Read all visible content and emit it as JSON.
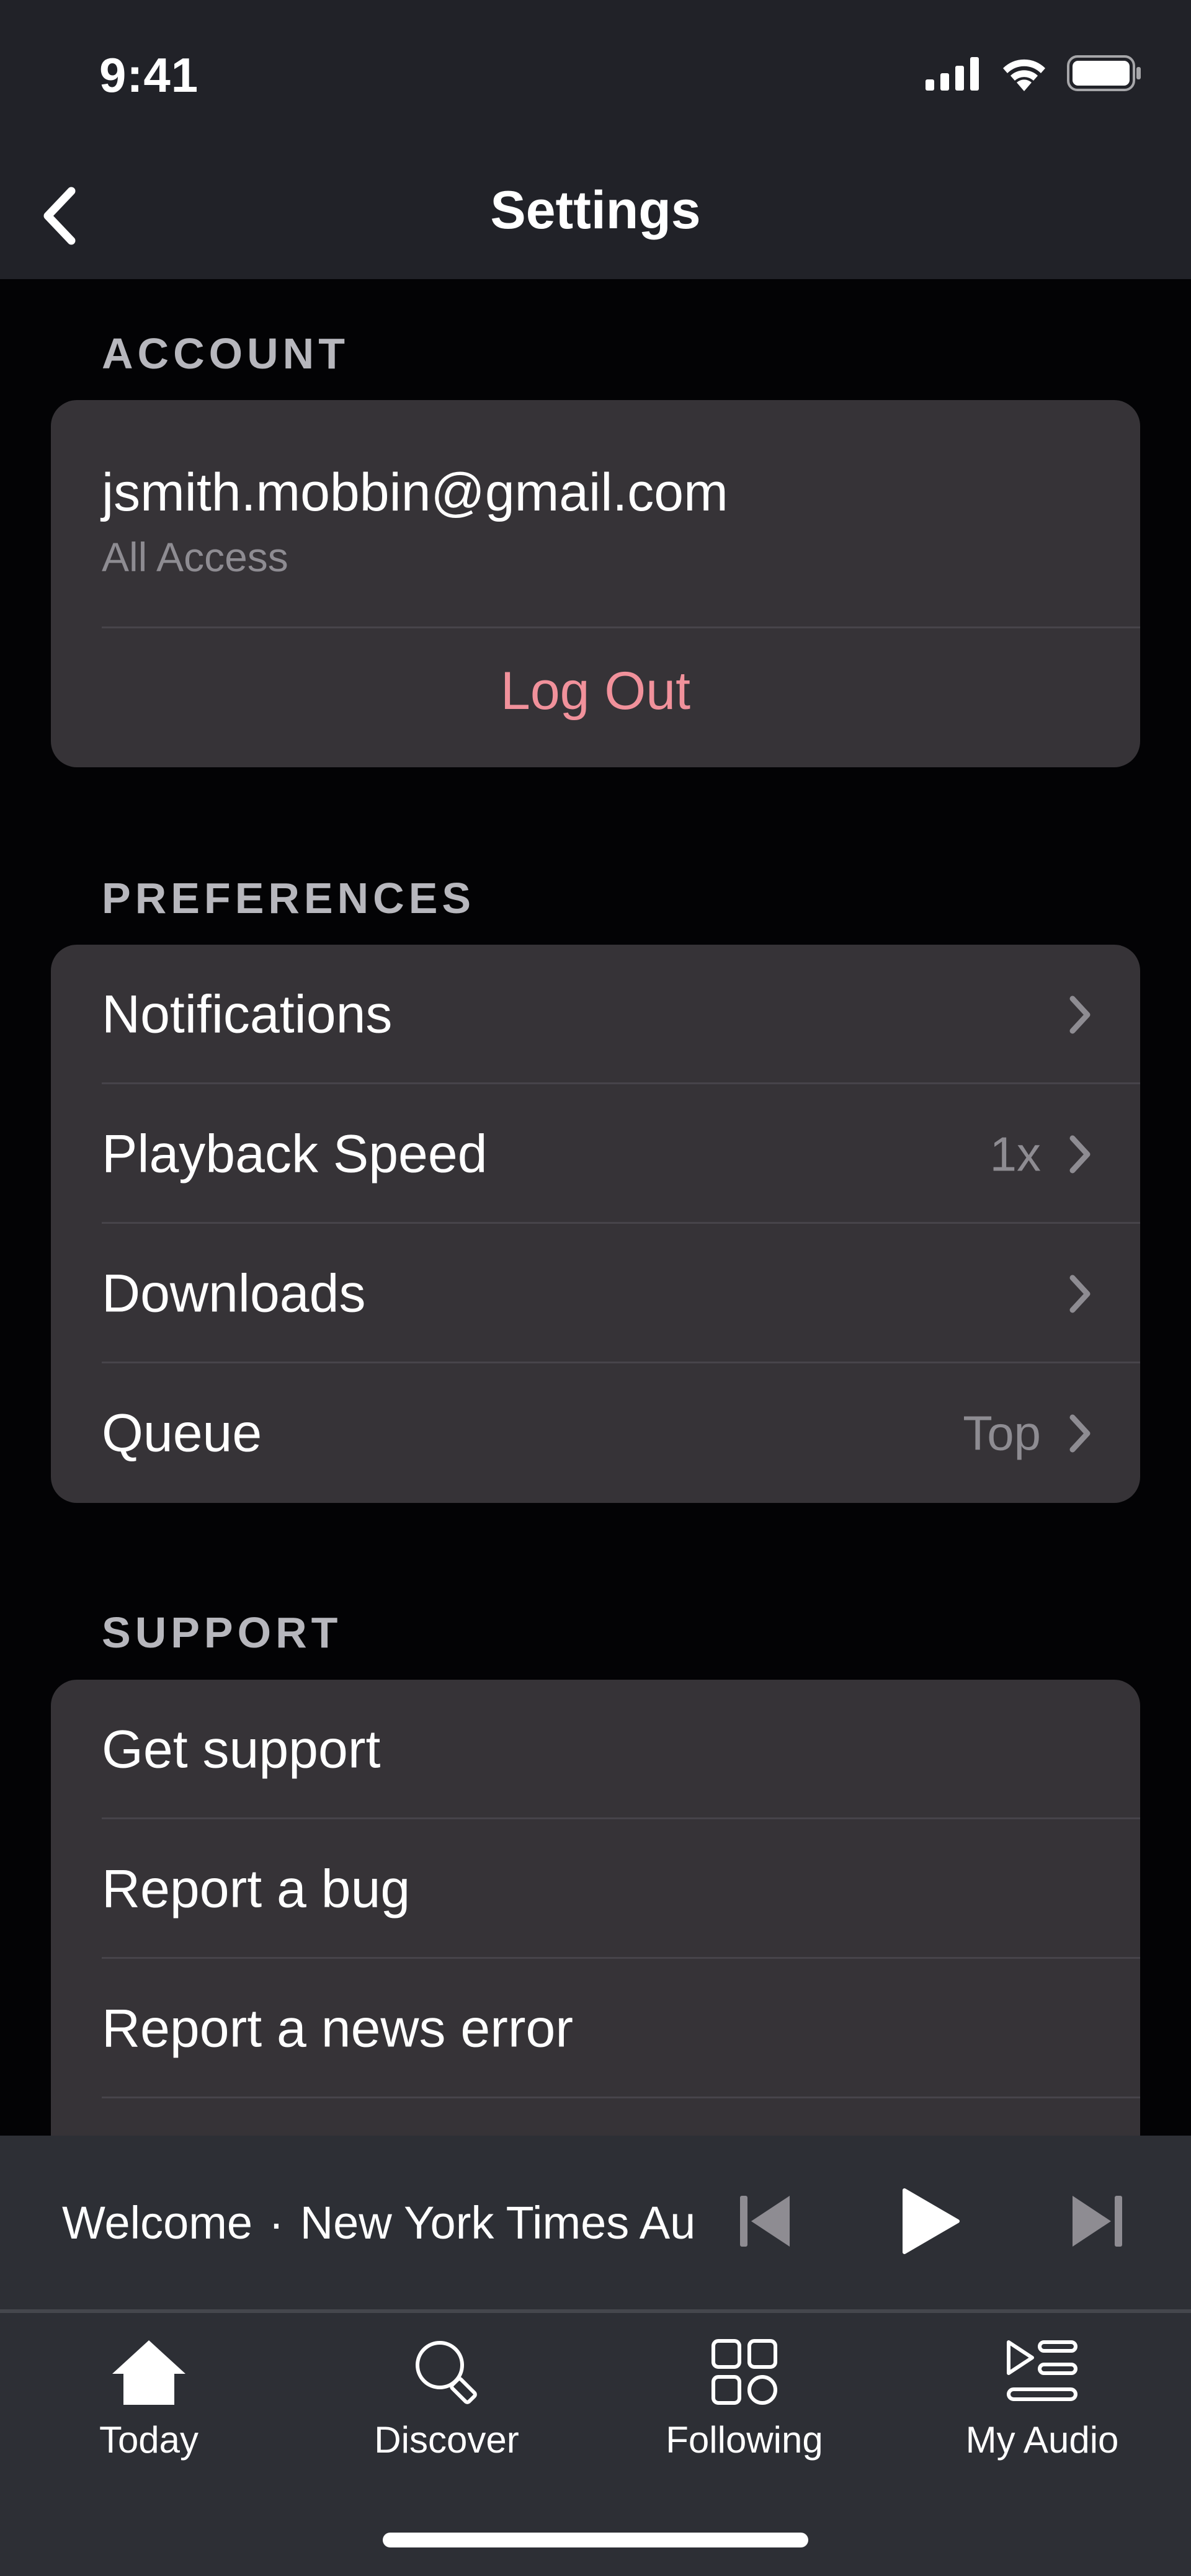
{
  "status_bar": {
    "time": "9:41"
  },
  "header": {
    "title": "Settings"
  },
  "account": {
    "section_title": "ACCOUNT",
    "email": "jsmith.mobbin@gmail.com",
    "plan": "All Access",
    "logout_label": "Log Out"
  },
  "preferences": {
    "section_title": "PREFERENCES",
    "items": [
      {
        "label": "Notifications",
        "value": ""
      },
      {
        "label": "Playback Speed",
        "value": "1x"
      },
      {
        "label": "Downloads",
        "value": ""
      },
      {
        "label": "Queue",
        "value": "Top"
      }
    ]
  },
  "support": {
    "section_title": "SUPPORT",
    "items": [
      {
        "label": "Get support"
      },
      {
        "label": "Report a bug"
      },
      {
        "label": "Report a news error"
      }
    ]
  },
  "mini_player": {
    "episode": "Welcome",
    "separator": "·",
    "show": "New York Times Audio"
  },
  "tabbar": {
    "items": [
      {
        "label": "Today",
        "icon": "home-icon"
      },
      {
        "label": "Discover",
        "icon": "search-icon"
      },
      {
        "label": "Following",
        "icon": "grid-icon"
      },
      {
        "label": "My Audio",
        "icon": "playlist-icon"
      }
    ]
  },
  "colors": {
    "background": "#030305",
    "bar_background": "#212228",
    "card": "#363337",
    "logout": "#f1919b",
    "secondary_text": "#8e8c92"
  }
}
